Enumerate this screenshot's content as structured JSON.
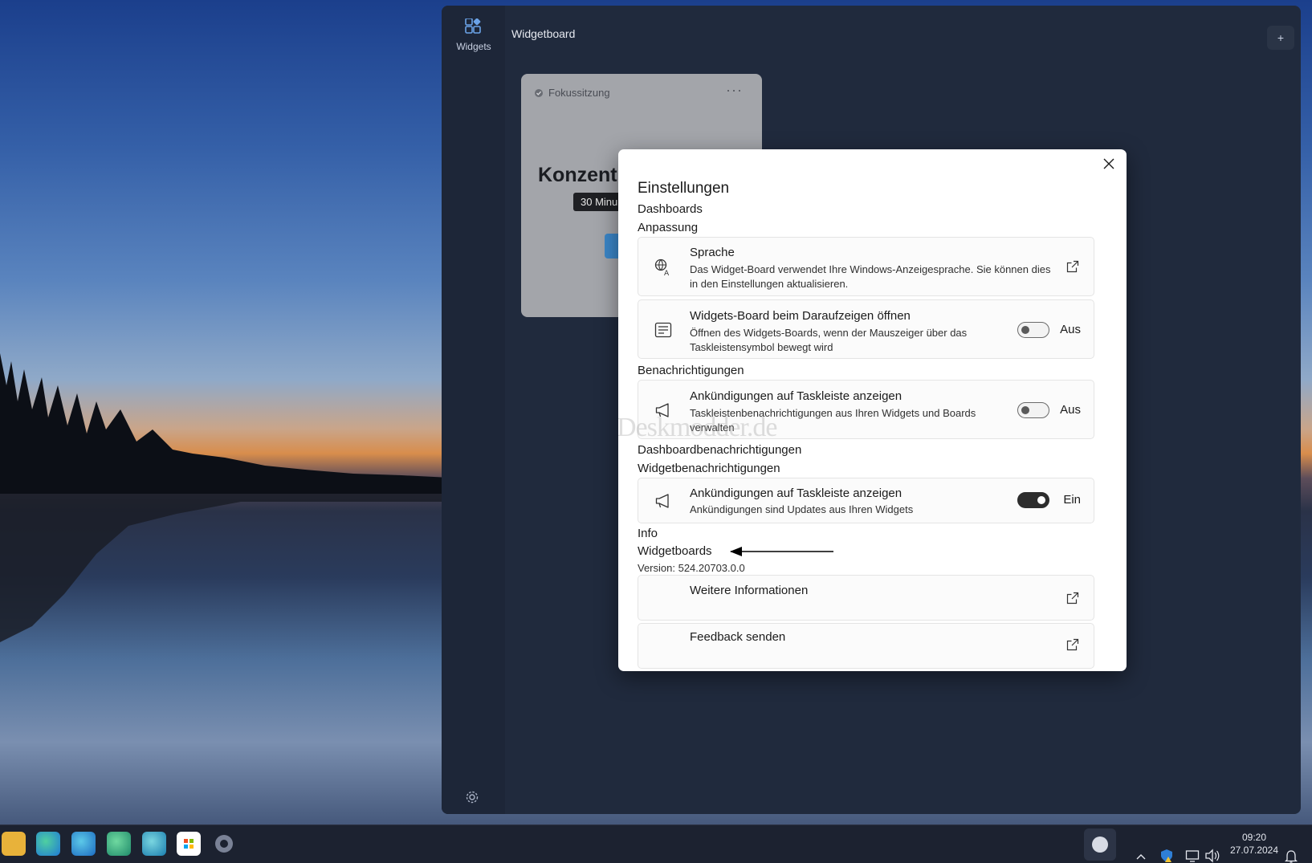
{
  "board": {
    "title": "Widgetboard",
    "rail_label": "Widgets",
    "plus_label": "+"
  },
  "focus_widget": {
    "title": "Fokussitzung",
    "headline": "Konzentr",
    "tooltip": "30 Minu"
  },
  "dialog": {
    "title": "Einstellungen",
    "section_dashboards": "Dashboards",
    "section_customization": "Anpassung",
    "language": {
      "title": "Sprache",
      "desc": "Das Widget-Board verwendet Ihre Windows-Anzeigesprache. Sie können dies in den Einstellungen aktualisieren."
    },
    "open_on_hover": {
      "title": "Widgets-Board beim Daraufzeigen öffnen",
      "desc": "Öffnen des Widgets-Boards, wenn der Mauszeiger über das Taskleistensymbol bewegt wird",
      "state_label": "Aus",
      "on": false
    },
    "section_notifications": "Benachrichtigungen",
    "taskbar_badges_1": {
      "title": "Ankündigungen auf Taskleiste anzeigen",
      "desc": "Taskleistenbenachrichtigungen aus Ihren Widgets und Boards verwalten",
      "state_label": "Aus",
      "on": false
    },
    "section_dashboard_notifications": "Dashboardbenachrichtigungen",
    "section_widget_notifications": "Widgetbenachrichtigungen",
    "taskbar_badges_2": {
      "title": "Ankündigungen auf Taskleiste anzeigen",
      "desc": "Ankündigungen sind Updates aus Ihren Widgets",
      "state_label": "Ein",
      "on": true
    },
    "section_info": "Info",
    "section_widgetboards": "Widgetboards",
    "version": "Version: 524.20703.0.0",
    "more_info": "Weitere Informationen",
    "feedback": "Feedback senden",
    "watermark": "Deskmodder.de"
  },
  "taskbar": {
    "time": "09:20",
    "date": "27.07.2024"
  }
}
